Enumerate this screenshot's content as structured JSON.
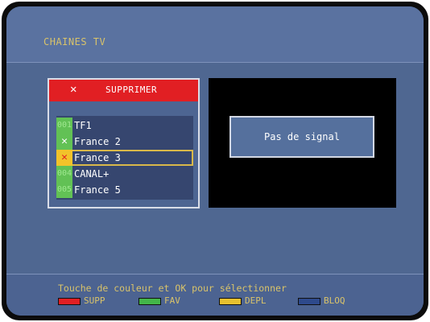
{
  "header": {
    "title": "CHAINES TV"
  },
  "delete_bar": {
    "icon": "x-icon",
    "label": "SUPPRIMER",
    "color": "#e11f23"
  },
  "channels": [
    {
      "number": "001",
      "name": "TF1",
      "marked": false,
      "selected": false
    },
    {
      "number": "✕",
      "name": "France 2",
      "marked": true,
      "selected": false
    },
    {
      "number": "✕",
      "name": "France 3",
      "marked": true,
      "selected": true
    },
    {
      "number": "004",
      "name": "CANAL+",
      "marked": false,
      "selected": false
    },
    {
      "number": "005",
      "name": "France 5",
      "marked": false,
      "selected": false
    }
  ],
  "preview": {
    "message": "Pas de signal"
  },
  "footer": {
    "hint": "Touche de couleur et OK pour sélectionner",
    "legend": [
      {
        "color": "#e11f23",
        "label": "SUPP"
      },
      {
        "color": "#43b649",
        "label": "FAV"
      },
      {
        "color": "#e7c12f",
        "label": "DEPL"
      },
      {
        "color": "#2e4a8c",
        "label": "BLOQ"
      }
    ]
  }
}
